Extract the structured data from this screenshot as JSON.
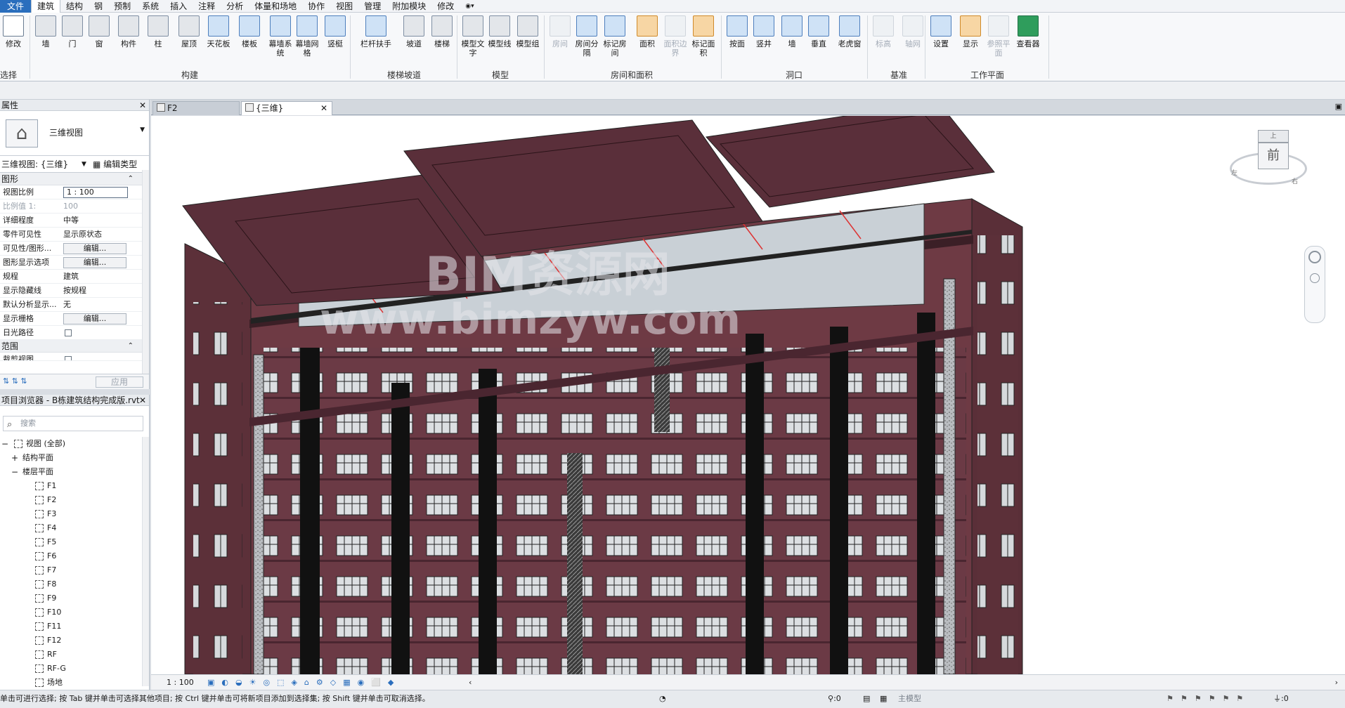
{
  "menu": [
    "文件",
    "建筑",
    "结构",
    "钢",
    "预制",
    "系统",
    "插入",
    "注释",
    "分析",
    "体量和场地",
    "协作",
    "视图",
    "管理",
    "附加模块",
    "修改"
  ],
  "ribbon": {
    "select_group": "选择",
    "buttons": [
      {
        "label": "修改",
        "icon": "cursor-icon"
      },
      {
        "label": "墙",
        "icon": "wall-icon"
      },
      {
        "label": "门",
        "icon": "door-icon"
      },
      {
        "label": "窗",
        "icon": "window-icon"
      },
      {
        "label": "构件",
        "icon": "component-icon"
      },
      {
        "label": "柱",
        "icon": "column-icon"
      },
      {
        "label": "屋顶",
        "icon": "roof-icon"
      },
      {
        "label": "天花板",
        "icon": "ceiling-icon"
      },
      {
        "label": "楼板",
        "icon": "floor-icon"
      },
      {
        "label": "幕墙系统",
        "icon": "curtain-system-icon"
      },
      {
        "label": "幕墙网格",
        "icon": "curtain-grid-icon"
      },
      {
        "label": "竖梃",
        "icon": "mullion-icon"
      },
      {
        "label": "栏杆扶手",
        "icon": "railing-icon"
      },
      {
        "label": "坡道",
        "icon": "ramp-icon"
      },
      {
        "label": "楼梯",
        "icon": "stair-icon"
      },
      {
        "label": "模型文字",
        "icon": "model-text-icon"
      },
      {
        "label": "模型线",
        "icon": "model-line-icon"
      },
      {
        "label": "模型组",
        "icon": "model-group-icon"
      },
      {
        "label": "房间",
        "icon": "room-icon"
      },
      {
        "label": "房间分隔",
        "icon": "room-separator-icon"
      },
      {
        "label": "标记房间",
        "icon": "tag-room-icon"
      },
      {
        "label": "面积",
        "icon": "area-icon"
      },
      {
        "label": "面积边界",
        "icon": "area-boundary-icon"
      },
      {
        "label": "标记面积",
        "icon": "tag-area-icon"
      },
      {
        "label": "按面",
        "icon": "by-face-icon"
      },
      {
        "label": "竖井",
        "icon": "shaft-icon"
      },
      {
        "label": "墙",
        "icon": "wall-opening-icon"
      },
      {
        "label": "垂直",
        "icon": "vertical-opening-icon"
      },
      {
        "label": "老虎窗",
        "icon": "dormer-icon"
      },
      {
        "label": "标高",
        "icon": "level-icon"
      },
      {
        "label": "轴网",
        "icon": "grid-icon"
      },
      {
        "label": "设置",
        "icon": "set-workplane-icon"
      },
      {
        "label": "显示",
        "icon": "show-workplane-icon"
      },
      {
        "label": "参照平面",
        "icon": "ref-plane-icon"
      },
      {
        "label": "查看器",
        "icon": "viewer-icon"
      }
    ],
    "groups": [
      "构建",
      "楼梯坡道",
      "模型",
      "房间和面积",
      "洞口",
      "基准",
      "工作平面"
    ]
  },
  "properties": {
    "title": "属性",
    "type_name": "三维视图",
    "selector": "三维视图: {三维}",
    "edit_type": "编辑类型",
    "section_graphics": "图形",
    "rows": [
      {
        "key": "视图比例",
        "value": "1 : 100"
      },
      {
        "key": "比例值 1:",
        "value": "100"
      },
      {
        "key": "详细程度",
        "value": "中等"
      },
      {
        "key": "零件可见性",
        "value": "显示原状态"
      },
      {
        "key": "可见性/图形...",
        "value": "编辑..."
      },
      {
        "key": "图形显示选项",
        "value": "编辑..."
      },
      {
        "key": "规程",
        "value": "建筑"
      },
      {
        "key": "显示隐藏线",
        "value": "按规程"
      },
      {
        "key": "默认分析显示...",
        "value": "无"
      },
      {
        "key": "显示栅格",
        "value": "编辑..."
      },
      {
        "key": "日光路径",
        "value": ""
      }
    ],
    "section_extents": "范围",
    "crop_view": "裁剪视图",
    "apply": "应用"
  },
  "browser": {
    "title": "项目浏览器 - B栋建筑结构完成版.rvt",
    "search_placeholder": "搜索",
    "root": "视图 (全部)",
    "structural_plans": "结构平面",
    "floor_plans": "楼层平面",
    "levels": [
      "F1",
      "F2",
      "F3",
      "F4",
      "F5",
      "F6",
      "F7",
      "F8",
      "F9",
      "F10",
      "F11",
      "F12",
      "RF",
      "RF-G",
      "场地"
    ]
  },
  "tabs": [
    {
      "label": "F2"
    },
    {
      "label": "{三维}"
    }
  ],
  "viewcube": {
    "front": "前",
    "top": "上",
    "left": "左",
    "right": "右"
  },
  "watermark": {
    "line1": "BIM资源网",
    "line2": "www.bimzyw.com"
  },
  "viewbar": {
    "scale": "1 : 100"
  },
  "status": {
    "message": "单击可进行选择; 按 Tab 键并单击可选择其他项目; 按 Ctrl 键并单击可将新项目添加到选择集; 按 Shift 键并单击可取消选择。",
    "count1": ":0",
    "model": "主模型",
    "count2": ":0"
  },
  "colors": {
    "accent": "#2a6ebd",
    "building": "#6e3a44",
    "roof": "#5a2f3a",
    "glass": "#c9d0d6"
  }
}
